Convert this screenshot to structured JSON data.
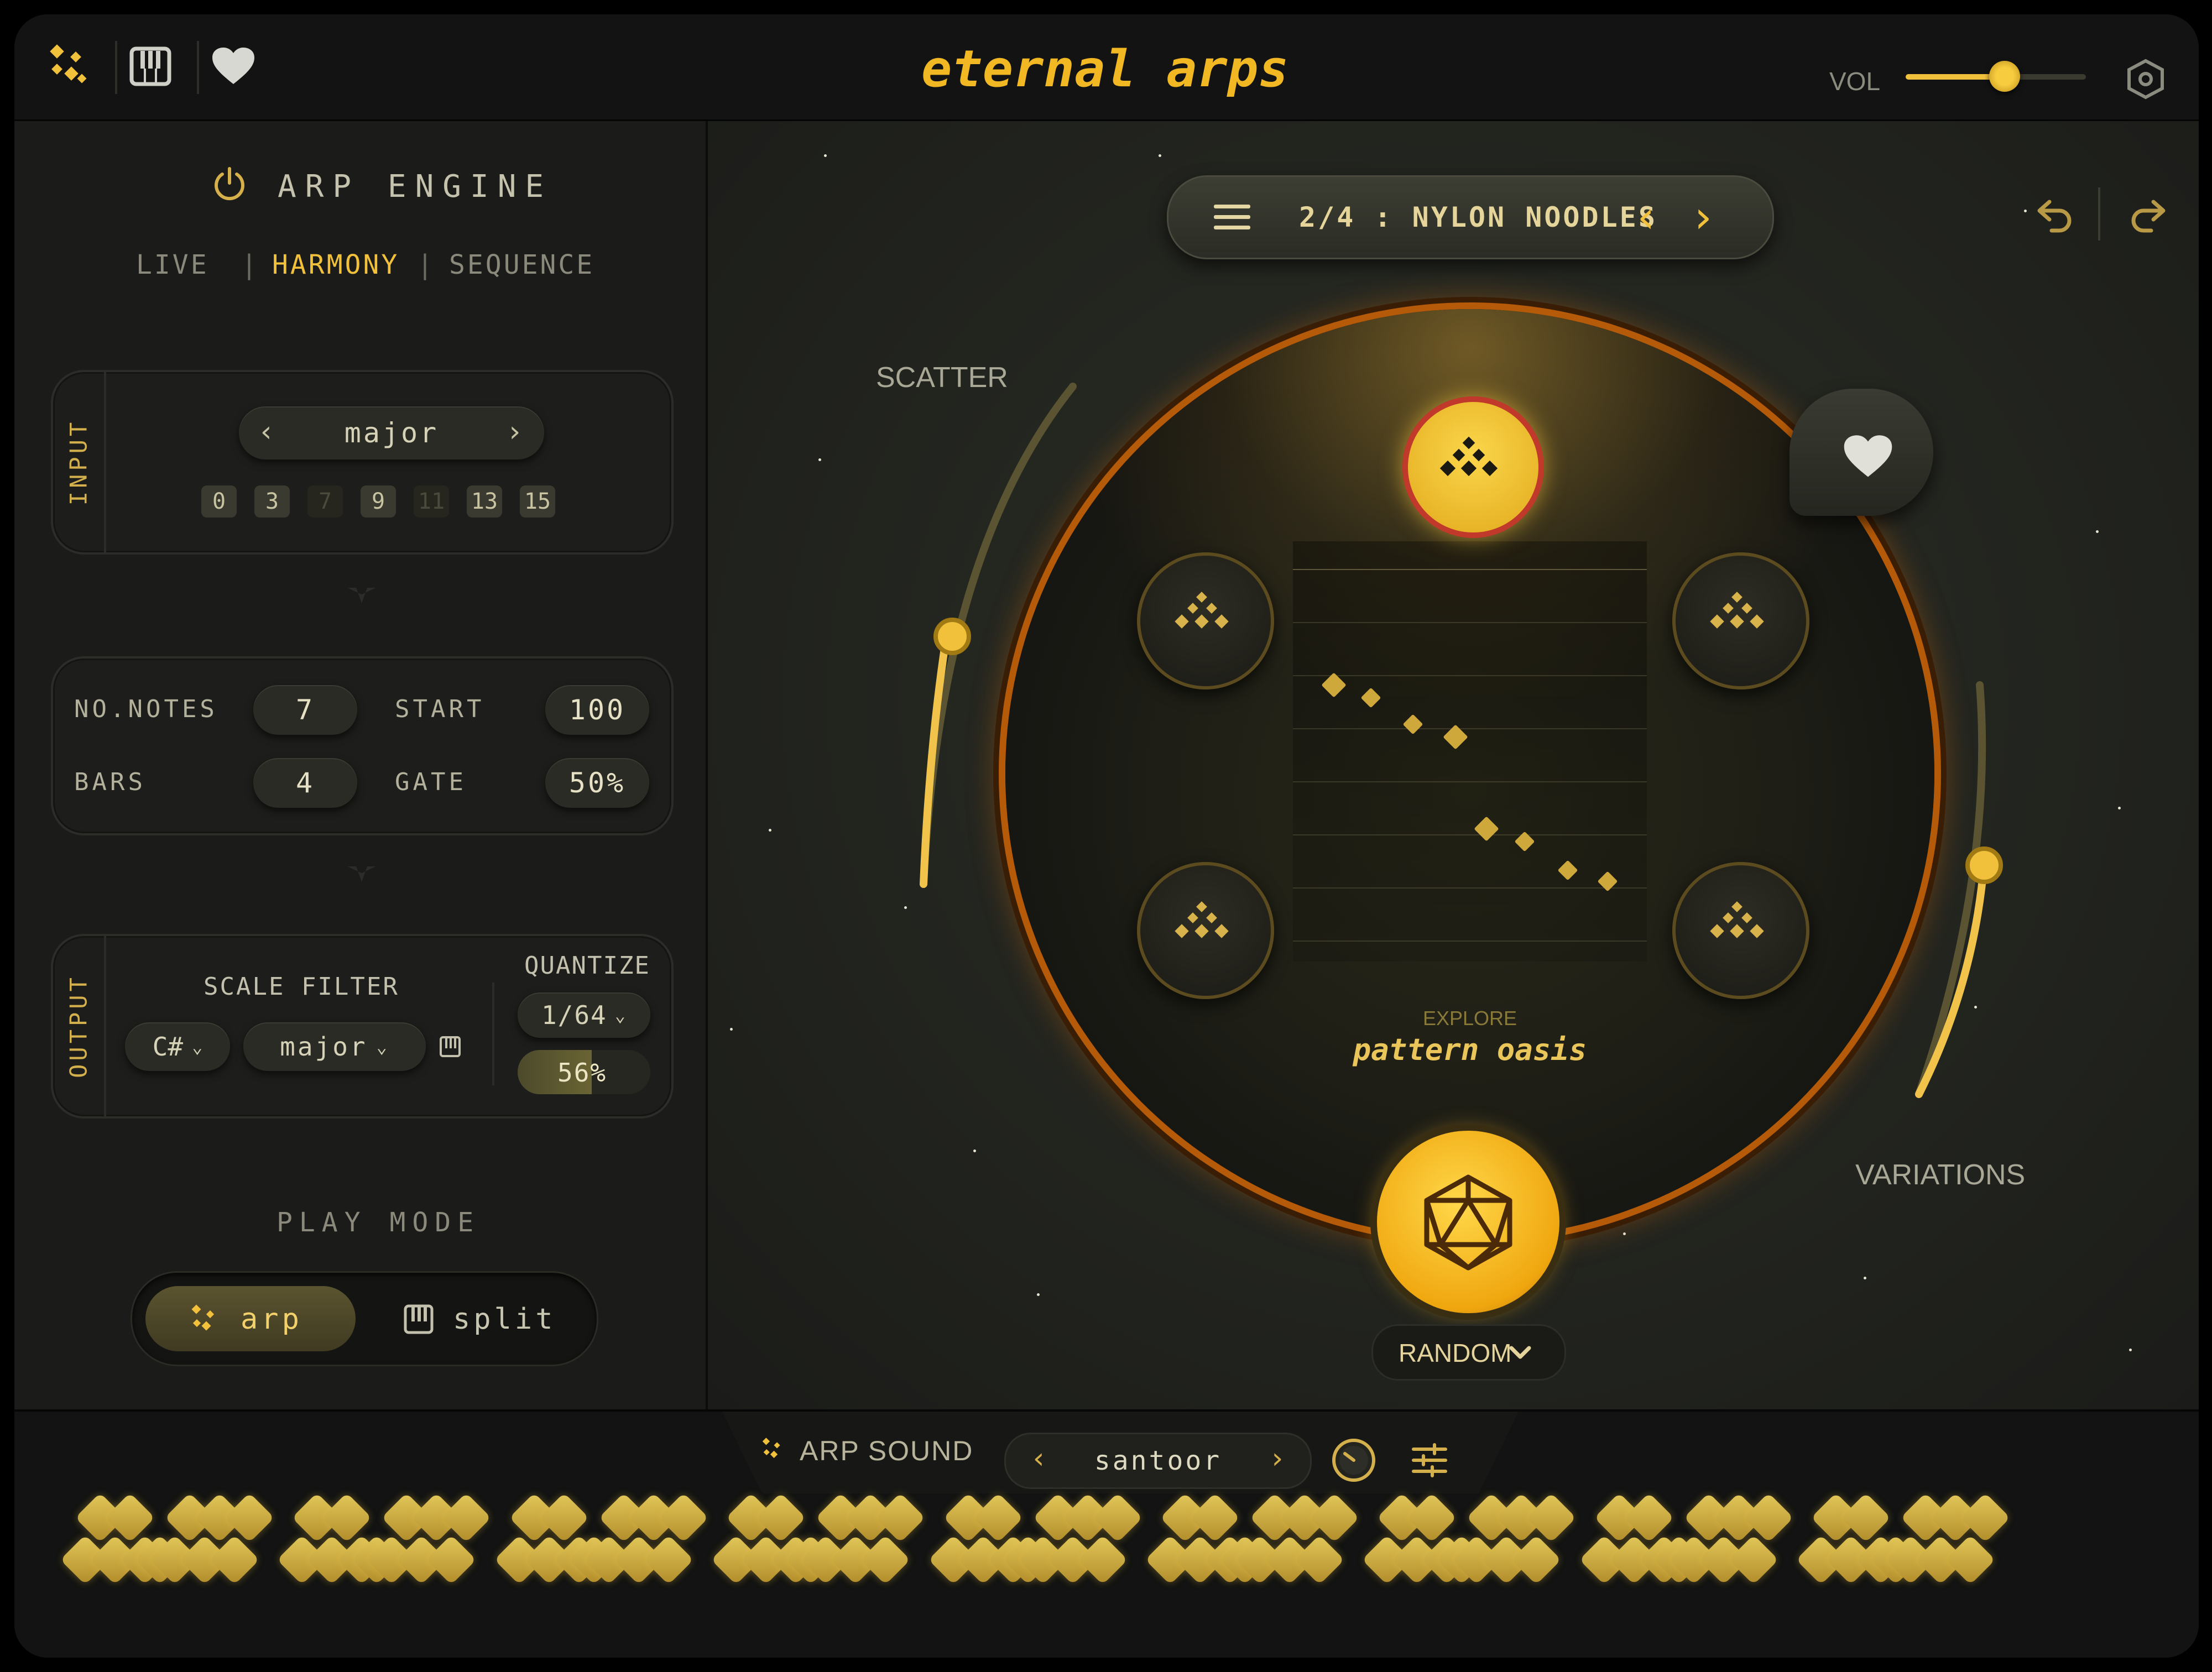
{
  "header": {
    "title": "eternal arps",
    "vol_label": "VOL",
    "vol_level": 0.55
  },
  "engine": {
    "title": "ARP ENGINE",
    "modes": [
      "LIVE",
      "HARMONY",
      "SEQUENCE"
    ],
    "active_mode": "HARMONY",
    "separator": "|"
  },
  "input": {
    "label": "INPUT",
    "scale": "major",
    "prev": "‹",
    "next": "›",
    "intervals": [
      "0",
      "3",
      "7",
      "9",
      "11",
      "13",
      "15"
    ],
    "intervals_active": [
      true,
      true,
      false,
      true,
      false,
      true,
      true
    ]
  },
  "params": {
    "no_notes_label": "NO.NOTES",
    "no_notes": "7",
    "start_label": "START",
    "start": "100",
    "bars_label": "BARS",
    "bars": "4",
    "gate_label": "GATE",
    "gate": "50%"
  },
  "output": {
    "label": "OUTPUT",
    "scale_filter_label": "SCALE FILTER",
    "key": "C#",
    "scale": "major",
    "quantize_label": "QUANTIZE",
    "quantize": "1/64",
    "quantize_amount": "56%",
    "quantize_fill": 0.56
  },
  "play_mode": {
    "label": "PLAY MODE",
    "options": [
      "arp",
      "split"
    ],
    "active": "arp"
  },
  "preset": {
    "name": "2/4 : NYLON NOODLES",
    "prev": "‹",
    "next": "›"
  },
  "scatter": {
    "label": "SCATTER",
    "level": 0.55
  },
  "variations": {
    "label": "VARIATIONS",
    "level": 0.55
  },
  "explore": {
    "label": "EXPLORE",
    "title": "pattern oasis"
  },
  "random": {
    "label": "RANDOM"
  },
  "arp_sound": {
    "label": "ARP SOUND",
    "instrument": "santoor",
    "prev": "‹",
    "next": "›"
  },
  "icons": {
    "logo": "diamond-cluster-icon",
    "keyboard": "piano-icon",
    "favorite": "heart-icon",
    "settings": "hexagon-gear-icon",
    "power": "power-icon",
    "menu": "hamburger-icon",
    "undo": "undo-icon",
    "redo": "redo-icon",
    "dice": "d20-icon",
    "knob": "knob-icon",
    "sliders": "sliders-icon"
  },
  "colors": {
    "accent": "#f2c13c",
    "ring": "#d9740f",
    "background": "#141514"
  }
}
